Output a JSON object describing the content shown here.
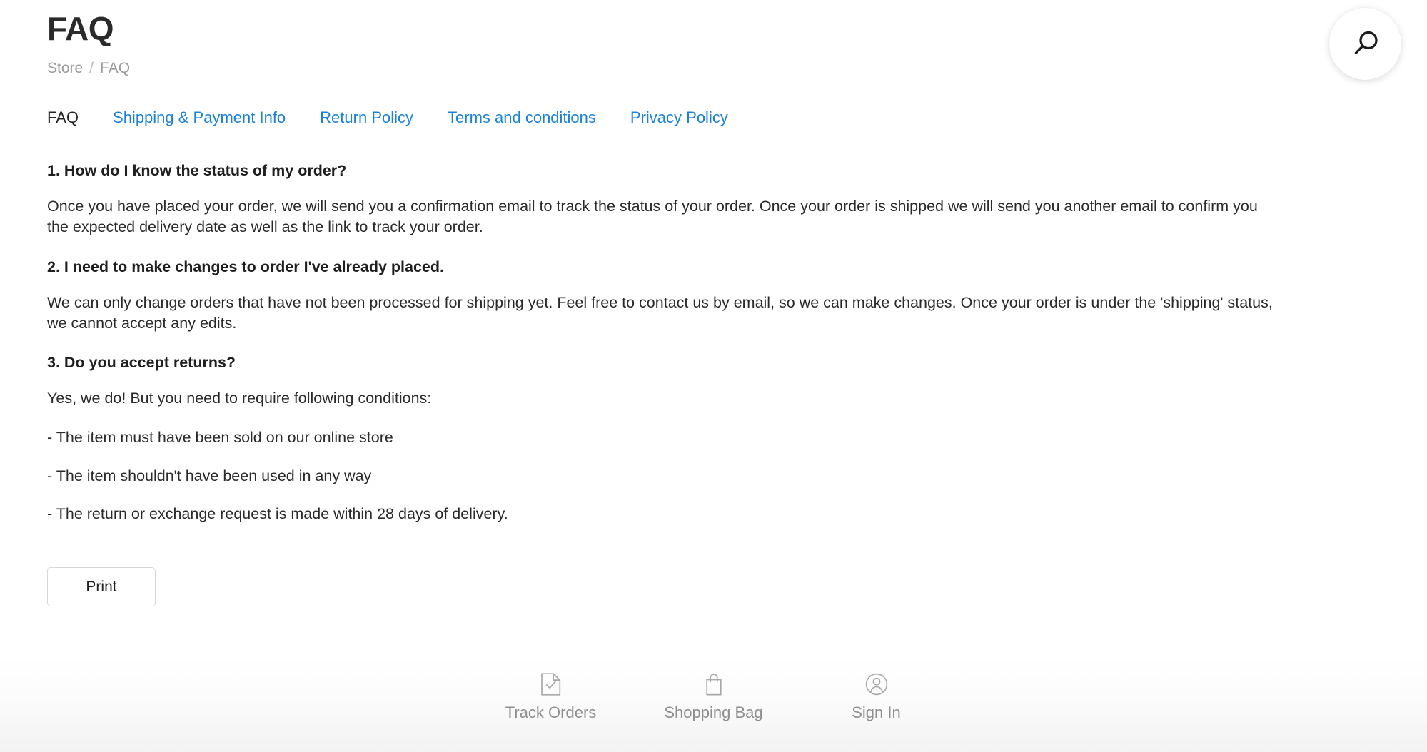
{
  "header": {
    "title": "FAQ",
    "breadcrumb": {
      "parent": "Store",
      "separator": "/",
      "current": "FAQ"
    }
  },
  "search": {
    "icon": "search-icon",
    "label": "Search"
  },
  "tabs": [
    {
      "label": "FAQ",
      "active": true
    },
    {
      "label": "Shipping & Payment Info",
      "active": false
    },
    {
      "label": "Return Policy",
      "active": false
    },
    {
      "label": "Terms and conditions",
      "active": false
    },
    {
      "label": "Privacy Policy",
      "active": false
    }
  ],
  "faq": [
    {
      "question": "1. How do I know the status of my order?",
      "answer": "Once you have placed your order, we will send you a confirmation email to track the status of your order. Once your order is shipped we will send you another email to confirm you the expected delivery date as well as the link to track your order.",
      "bullets": []
    },
    {
      "question": "2. I need to make changes to order I've already placed.",
      "answer": "We can only change orders that have not been processed for shipping yet. Feel free to contact us by email, so we can make changes. Once your order is under the 'shipping' status, we cannot accept any edits.",
      "bullets": []
    },
    {
      "question": "3. Do you accept returns?",
      "answer": "Yes, we do! But you need to require following conditions:",
      "bullets": [
        "- The item must have been sold on our online store",
        "- The item shouldn't have been used in any way",
        "- The return or exchange request is made within 28 days of delivery."
      ]
    }
  ],
  "actions": {
    "print_label": "Print"
  },
  "bottom_nav": [
    {
      "label": "Track Orders",
      "icon": "document-check-icon"
    },
    {
      "label": "Shopping Bag",
      "icon": "shopping-bag-icon"
    },
    {
      "label": "Sign In",
      "icon": "user-circle-icon"
    }
  ],
  "colors": {
    "link": "#1a82d8",
    "text": "#2a2a2a",
    "muted": "#9a9a9a",
    "border": "#d8d8d8"
  }
}
